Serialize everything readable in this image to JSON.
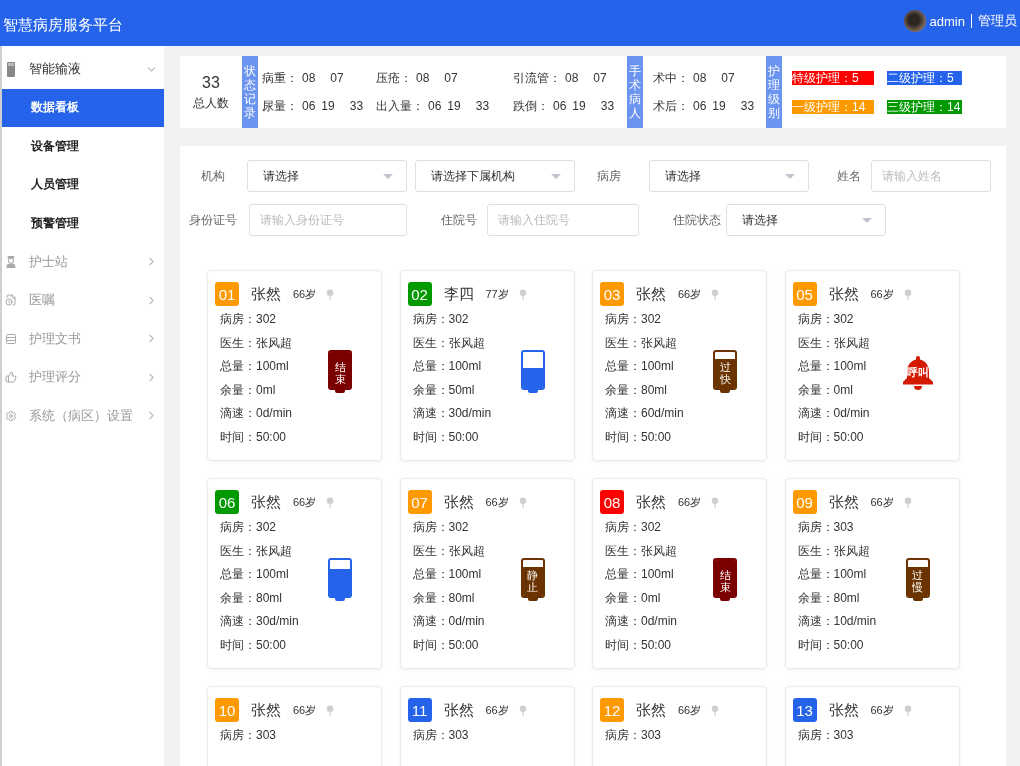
{
  "header": {
    "title": "智慧病房服务平台",
    "user": "admin",
    "role": "管理员"
  },
  "sidebar": {
    "items": [
      {
        "label": "智能输液",
        "expanded": true,
        "children": [
          {
            "label": "数据看板",
            "selected": true
          },
          {
            "label": "设备管理",
            "selected": false
          },
          {
            "label": "人员管理",
            "selected": false
          },
          {
            "label": "预警管理",
            "selected": false
          }
        ]
      },
      {
        "label": "护士站",
        "expanded": false
      },
      {
        "label": "医嘱",
        "expanded": false
      },
      {
        "label": "护理文书",
        "expanded": false
      },
      {
        "label": "护理评分",
        "expanded": false
      },
      {
        "label": "系统（病区）设置",
        "expanded": false
      }
    ]
  },
  "summary": {
    "total": {
      "value": "33",
      "label": "总人数"
    },
    "groups": [
      {
        "title": "状态记录",
        "kind": "stats",
        "items": [
          {
            "label": "病重：",
            "values": [
              "08",
              "07"
            ]
          },
          {
            "label": "压疮：",
            "values": [
              "08",
              "07"
            ]
          },
          {
            "label": "引流管：",
            "values": [
              "08",
              "07"
            ]
          },
          {
            "label": "尿量：",
            "values": [
              "06",
              "19",
              "33"
            ]
          },
          {
            "label": "出入量：",
            "values": [
              "06",
              "19",
              "33"
            ]
          },
          {
            "label": "跌倒：",
            "values": [
              "06",
              "19",
              "33"
            ]
          }
        ]
      },
      {
        "title": "手术病人",
        "kind": "stats",
        "items": [
          {
            "label": "术中：",
            "values": [
              "08",
              "07"
            ]
          },
          {
            "label": "术后：",
            "values": [
              "06",
              "19",
              "33"
            ]
          }
        ]
      },
      {
        "title": "护理级别",
        "kind": "levels",
        "items": [
          {
            "label": "特级护理：5",
            "color": "#ff0000"
          },
          {
            "label": "二级护理：5",
            "color": "#2563eb"
          },
          {
            "label": "一级护理：14",
            "color": "#ff9900"
          },
          {
            "label": "三级护理：14",
            "color": "#009900"
          }
        ]
      }
    ]
  },
  "filters": {
    "rows": [
      [
        {
          "label": "机构",
          "kind": "select",
          "value": "请选择"
        },
        {
          "kind": "select",
          "value": "请选择下属机构"
        },
        {
          "label": "病房",
          "kind": "select",
          "value": "请选择"
        },
        {
          "label": "姓名",
          "kind": "input",
          "placeholder": "请输入姓名"
        }
      ],
      [
        {
          "label": "身份证号",
          "kind": "input",
          "placeholder": "请输入身份证号"
        },
        {
          "label": "住院号",
          "kind": "input",
          "placeholder": "请输入住院号"
        },
        {
          "label": "住院状态",
          "kind": "select",
          "value": "请选择"
        }
      ]
    ]
  },
  "cards": [
    {
      "number": "01",
      "color": "#ff9900",
      "name": "张然",
      "age": "66岁",
      "lines": [
        "病房：302",
        "医生：张风超",
        "总量：100ml",
        "余量：0ml",
        "滴速：0d/min",
        "时间：50:00"
      ],
      "status": {
        "kind": "end",
        "label": "结束",
        "level": 1
      }
    },
    {
      "number": "02",
      "color": "#009900",
      "name": "李四",
      "age": "77岁",
      "lines": [
        "病房：302",
        "医生：张风超",
        "总量：100ml",
        "余量：50ml",
        "滴速：30d/min",
        "时间：50:00"
      ],
      "status": {
        "kind": "normal",
        "level": 0.55
      }
    },
    {
      "number": "03",
      "color": "#ff9900",
      "name": "张然",
      "age": "66岁",
      "lines": [
        "病房：302",
        "医生：张风超",
        "总量：100ml",
        "余量：80ml",
        "滴速：60d/min",
        "时间：50:00"
      ],
      "status": {
        "kind": "fast",
        "label": "过快",
        "level": 0.8
      }
    },
    {
      "number": "05",
      "color": "#ff9900",
      "name": "张然",
      "age": "66岁",
      "lines": [
        "病房：302",
        "医生：张风超",
        "总量：100ml",
        "余量：0ml",
        "滴速：0d/min",
        "时间：50:00"
      ],
      "status": {
        "kind": "call",
        "label": "呼叫"
      }
    },
    {
      "number": "06",
      "color": "#009900",
      "name": "张然",
      "age": "66岁",
      "lines": [
        "病房：302",
        "医生：张风超",
        "总量：100ml",
        "余量：80ml",
        "滴速：30d/min",
        "时间：50:00"
      ],
      "status": {
        "kind": "normal",
        "level": 0.75
      }
    },
    {
      "number": "07",
      "color": "#ff9900",
      "name": "张然",
      "age": "66岁",
      "lines": [
        "病房：302",
        "医生：张风超",
        "总量：100ml",
        "余量：80ml",
        "滴速：0d/min",
        "时间：50:00"
      ],
      "status": {
        "kind": "still",
        "label": "静止",
        "level": 0.8
      }
    },
    {
      "number": "08",
      "color": "#ff0000",
      "name": "张然",
      "age": "66岁",
      "lines": [
        "病房：302",
        "医生：张风超",
        "总量：100ml",
        "余量：0ml",
        "滴速：0d/min",
        "时间：50:00"
      ],
      "status": {
        "kind": "end",
        "label": "结束",
        "level": 1
      }
    },
    {
      "number": "09",
      "color": "#ff9900",
      "name": "张然",
      "age": "66岁",
      "lines": [
        "病房：303",
        "医生：张风超",
        "总量：100ml",
        "余量：80ml",
        "滴速：10d/min",
        "时间：50:00"
      ],
      "status": {
        "kind": "slow",
        "label": "过慢",
        "level": 0.8
      }
    },
    {
      "number": "10",
      "color": "#ff9900",
      "name": "张然",
      "age": "66岁",
      "lines": [
        "病房：303"
      ]
    },
    {
      "number": "11",
      "color": "#2563eb",
      "name": "张然",
      "age": "66岁",
      "lines": [
        "病房：303"
      ]
    },
    {
      "number": "12",
      "color": "#ff9900",
      "name": "张然",
      "age": "66岁",
      "lines": [
        "病房：303"
      ]
    },
    {
      "number": "13",
      "color": "#2563eb",
      "name": "张然",
      "age": "66岁",
      "lines": [
        "病房：303"
      ]
    }
  ]
}
